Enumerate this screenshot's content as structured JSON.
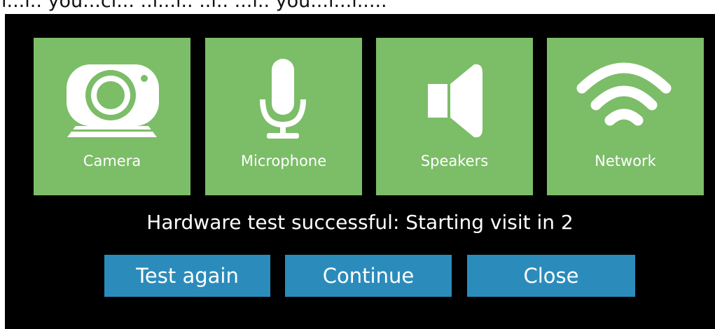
{
  "background_text": "l...l.. you...cl... ..l...l.. ..l.. ...l.. you...l...l.....",
  "tiles": [
    {
      "label": "Camera",
      "icon": "camera-icon"
    },
    {
      "label": "Microphone",
      "icon": "microphone-icon"
    },
    {
      "label": "Speakers",
      "icon": "speaker-icon"
    },
    {
      "label": "Network",
      "icon": "wifi-icon"
    }
  ],
  "status": "Hardware test successful: Starting visit in 2",
  "buttons": {
    "test_again": "Test again",
    "continue": "Continue",
    "close": "Close"
  },
  "colors": {
    "tile": "#7cbd68",
    "button": "#2b8cbb",
    "dialog_bg": "#000000",
    "text": "#ffffff"
  }
}
